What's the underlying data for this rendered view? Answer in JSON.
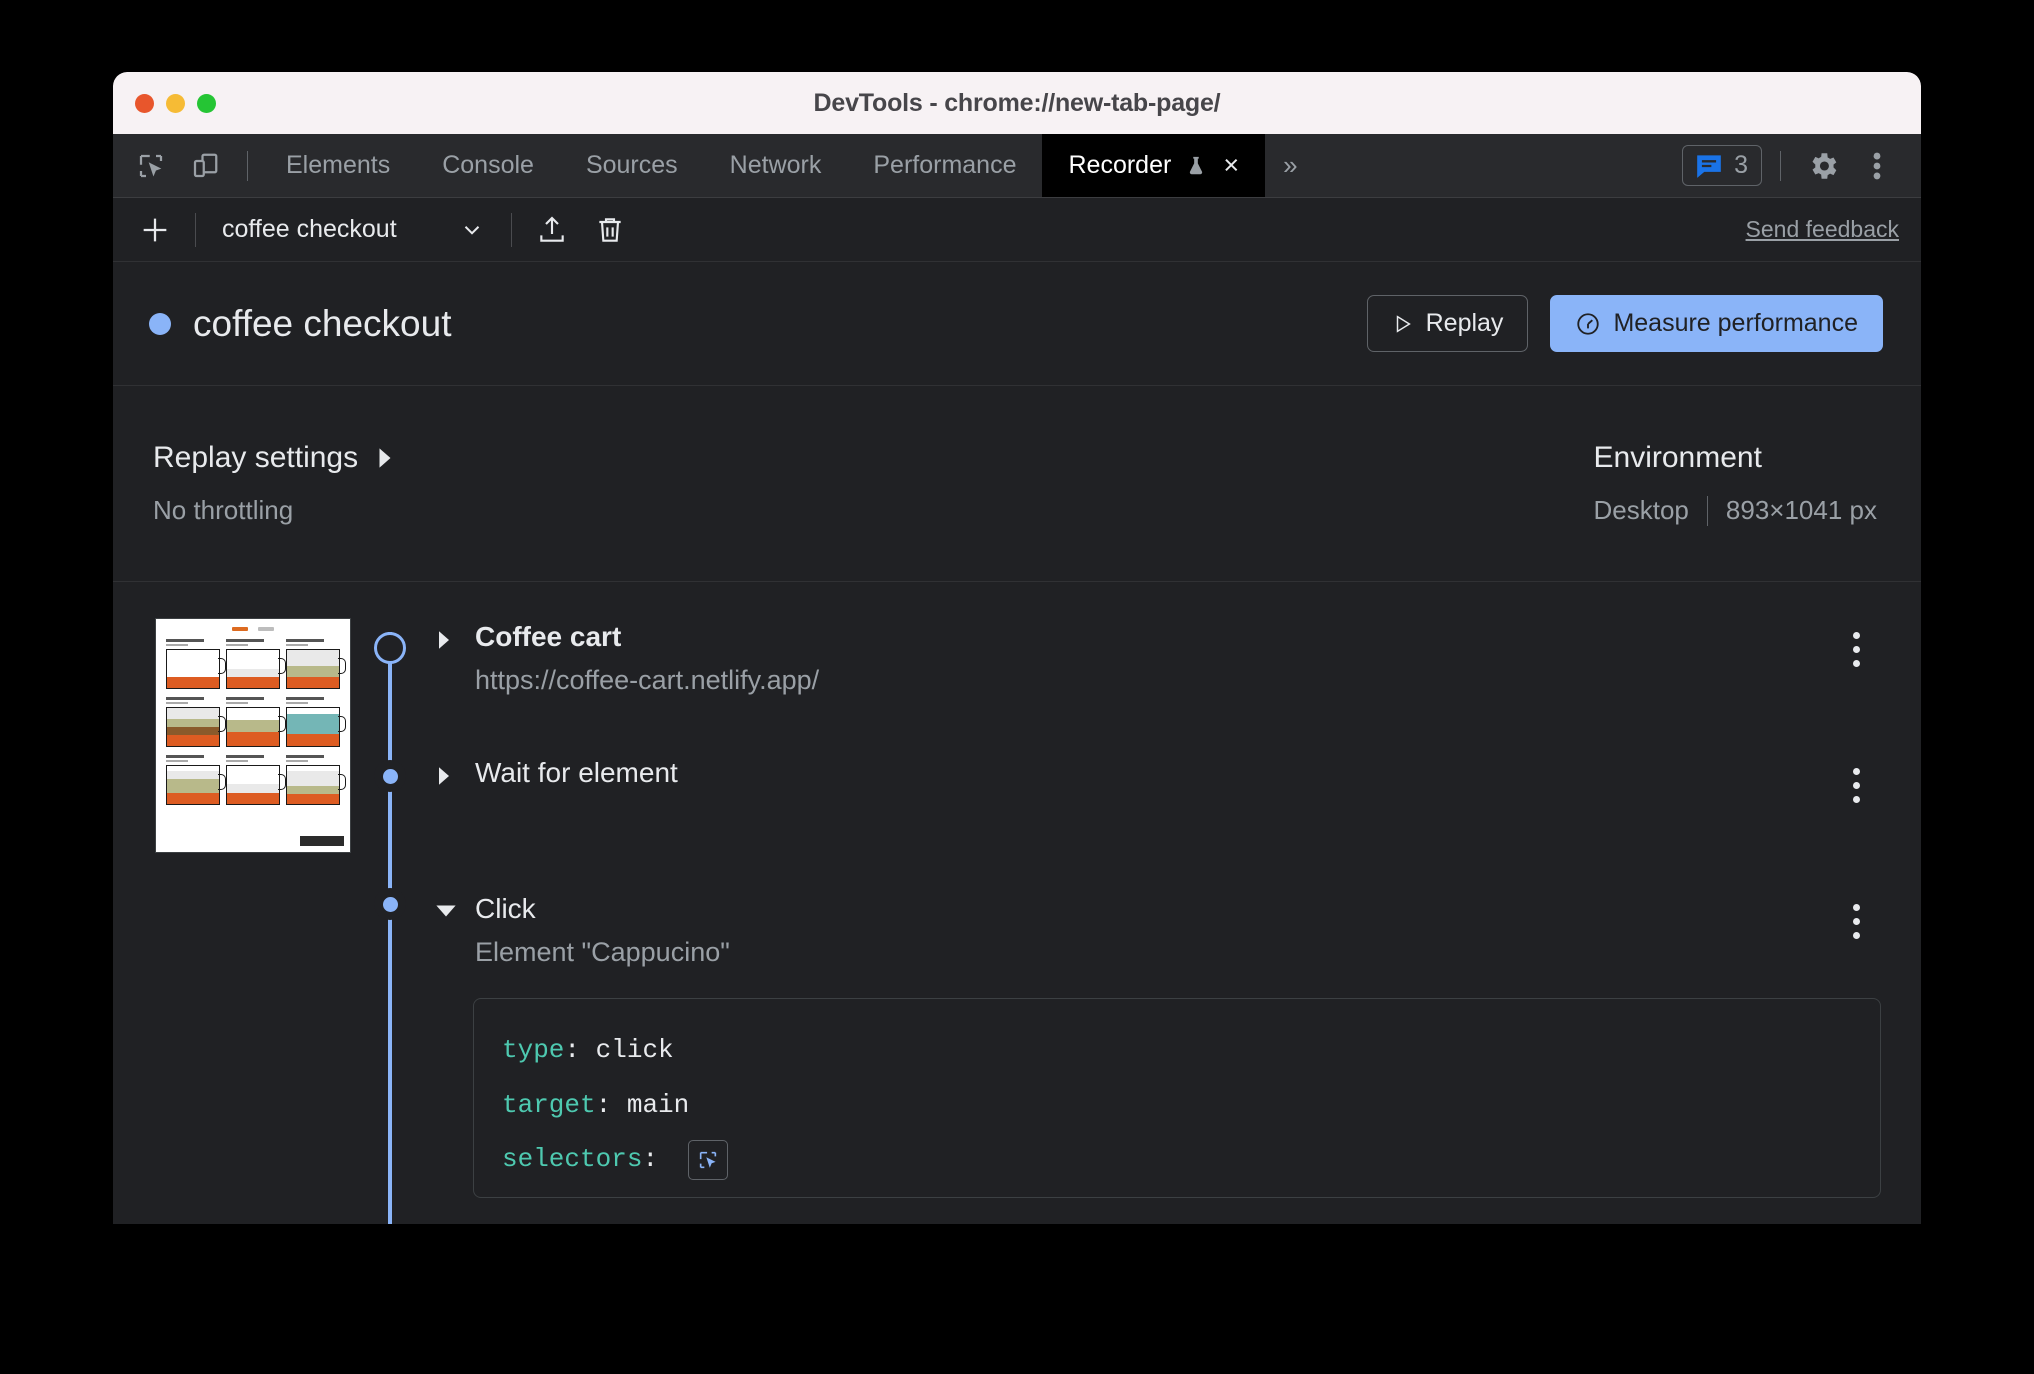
{
  "window": {
    "title": "DevTools - chrome://new-tab-page/",
    "traffic_lights": [
      "close",
      "minimize",
      "maximize"
    ]
  },
  "tabbar": {
    "left_icons": [
      "inspect-element-icon",
      "device-toolbar-icon"
    ],
    "tabs": [
      {
        "label": "Elements",
        "active": false
      },
      {
        "label": "Console",
        "active": false
      },
      {
        "label": "Sources",
        "active": false
      },
      {
        "label": "Network",
        "active": false
      },
      {
        "label": "Performance",
        "active": false
      },
      {
        "label": "Recorder",
        "active": true,
        "experiment": true,
        "closable": true
      }
    ],
    "more_tabs_label": "»",
    "close_label": "×",
    "issues_count": "3",
    "right_icons": [
      "issues-icon",
      "settings-gear-icon",
      "more-options-icon"
    ]
  },
  "recorder_toolbar": {
    "add_label": "+",
    "recording_name": "coffee checkout",
    "export_icon": "export-icon",
    "delete_icon": "delete-icon",
    "send_feedback": "Send feedback"
  },
  "recording_header": {
    "title": "coffee checkout",
    "replay_label": "Replay",
    "measure_label": "Measure performance",
    "accent_color": "#8ab4f8"
  },
  "settings": {
    "replay_settings_label": "Replay settings",
    "throttling": "No throttling",
    "environment_label": "Environment",
    "environment_device": "Desktop",
    "environment_size": "893×1041 px"
  },
  "steps": [
    {
      "title": "Coffee cart",
      "subtitle": "https://coffee-cart.netlify.app/",
      "expanded": false,
      "bold": true,
      "node": "ring"
    },
    {
      "title": "Wait for element",
      "subtitle": "",
      "expanded": false,
      "bold": false,
      "node": "dot"
    },
    {
      "title": "Click",
      "subtitle": "Element \"Cappucino\"",
      "expanded": true,
      "bold": false,
      "node": "dot"
    }
  ],
  "code": {
    "lines": [
      {
        "key": "type",
        "value": "click"
      },
      {
        "key": "target",
        "value": "main"
      },
      {
        "key": "selectors",
        "value": "",
        "has_selector_button": true
      }
    ],
    "selector_button_icon": "select-element-icon",
    "key_color": "#4ec9b0",
    "value_color": "#e8eaed"
  }
}
